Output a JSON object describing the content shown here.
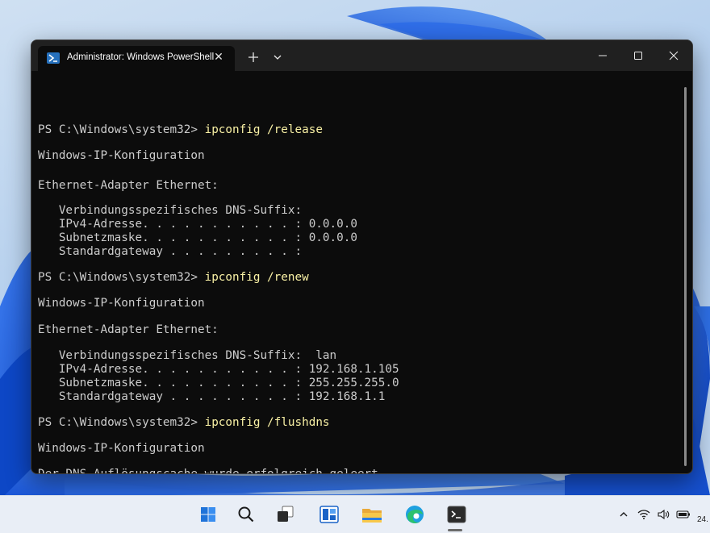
{
  "window": {
    "tab_title": "Administrator: Windows PowerShell",
    "tab_close_glyph": "✕",
    "icons": [
      "powershell-icon",
      "new-tab-icon",
      "dropdown-chevron-icon",
      "minimize-icon",
      "maximize-icon",
      "close-icon"
    ]
  },
  "terminal": {
    "prompt": "PS C:\\Windows\\system32> ",
    "block1": {
      "cmd": "ipconfig /release",
      "heading": "Windows-IP-Konfiguration",
      "adapter": "Ethernet-Adapter Ethernet:",
      "dns_suffix": "   Verbindungsspezifisches DNS-Suffix:",
      "ipv4": "   IPv4-Adresse. . . . . . . . . . . : 0.0.0.0",
      "subnet": "   Subnetzmaske. . . . . . . . . . . : 0.0.0.0",
      "gateway": "   Standardgateway . . . . . . . . . :"
    },
    "block2": {
      "cmd": "ipconfig /renew",
      "heading": "Windows-IP-Konfiguration",
      "adapter": "Ethernet-Adapter Ethernet:",
      "dns_suffix": "   Verbindungsspezifisches DNS-Suffix:  lan",
      "ipv4": "   IPv4-Adresse. . . . . . . . . . . : 192.168.1.105",
      "subnet": "   Subnetzmaske. . . . . . . . . . . : 255.255.255.0",
      "gateway": "   Standardgateway . . . . . . . . . : 192.168.1.1"
    },
    "block3": {
      "cmd": "ipconfig /flushdns",
      "heading": "Windows-IP-Konfiguration",
      "message": "Der DNS-Auflösungscache wurde erfolgreich geleert."
    },
    "colors": {
      "background": "#0c0c0c",
      "text": "#cccccc",
      "command": "#f9f1a5"
    }
  },
  "taskbar": {
    "apps": [
      "start-icon",
      "search-icon",
      "task-view-icon",
      "widgets-icon",
      "file-explorer-icon",
      "edge-icon",
      "terminal-icon"
    ],
    "tray": [
      "chevron-up-icon",
      "wifi-icon",
      "speaker-icon",
      "battery-icon"
    ],
    "clock": "24."
  }
}
